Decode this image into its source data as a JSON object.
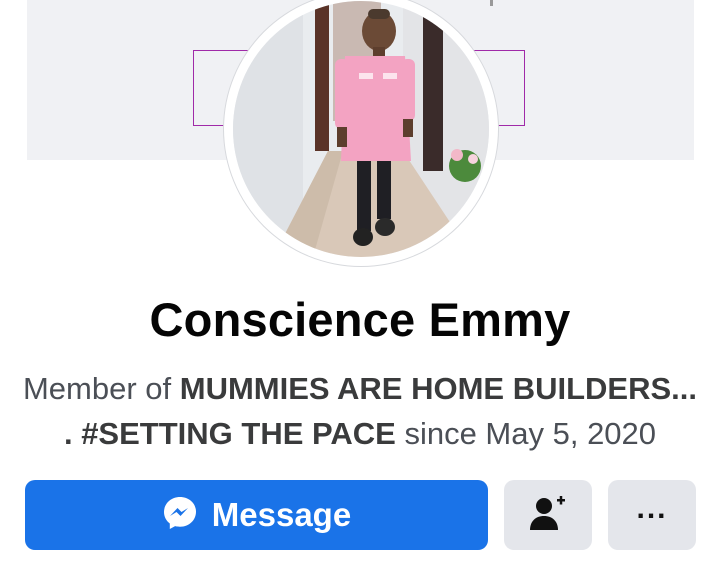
{
  "profile": {
    "name": "Conscience Emmy",
    "bio_prefix": "Member of ",
    "group_name_line1": "MUMMIES ARE HOME BUILDERS...",
    "group_name_line2": ". #SETTING THE PACE",
    "bio_since": " since May 5, 2020"
  },
  "actions": {
    "message_label": "Message",
    "message_icon": "messenger-icon",
    "add_friend_icon": "add-friend-icon",
    "more_label": "..."
  },
  "colors": {
    "primary": "#1a73e8",
    "secondary_button": "#e4e6eb",
    "cover_background": "#f0f1f4",
    "cover_frame": "#a02aa8"
  }
}
